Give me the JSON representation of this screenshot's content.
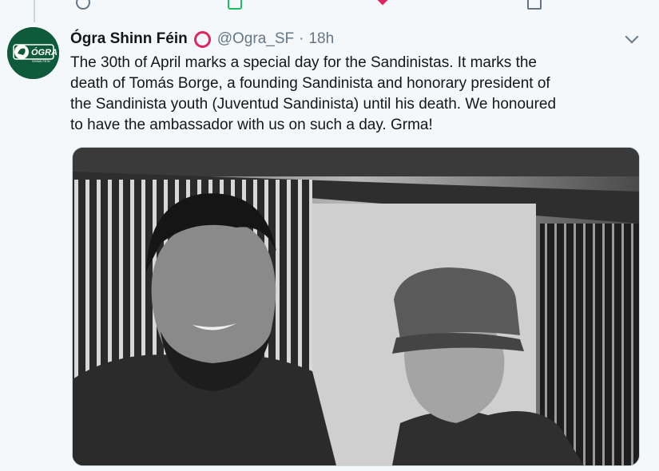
{
  "tweet": {
    "display_name": "Ógra Shinn Féin",
    "handle": "@Ogra_SF",
    "separator": "·",
    "time": "18h",
    "text": "The 30th of April marks a special day for the Sandinistas. It marks the\ndeath of Tomás Borge, a founding Sandinista and honorary president of\nthe Sandinista youth (Juventud Sandinista) until his death. We honoured\nto have the ambassador with us on such a day. Grma!",
    "avatar_logo_text": "ÓGRA",
    "avatar_logo_subtext": "SHINN FÉIN",
    "badge_icon": "red-circle-emoji",
    "menu_icon": "chevron-down-icon"
  },
  "colors": {
    "background": "#f5f8fa",
    "name": "#14171a",
    "muted": "#657786",
    "badge": "#e0245e",
    "avatar_bg": "#0f5a3a",
    "retweet": "#17bf63",
    "like": "#e0245e"
  },
  "actions": {
    "reply_icon": "reply-icon",
    "retweet_icon": "retweet-icon",
    "like_icon": "heart-icon",
    "share_icon": "share-icon"
  }
}
